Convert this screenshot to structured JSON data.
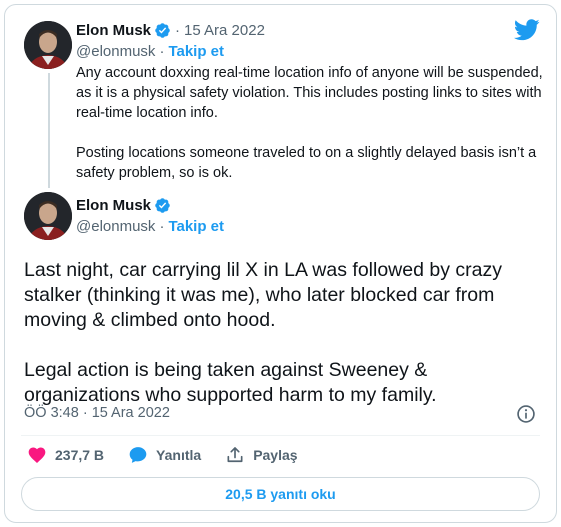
{
  "quoted_tweet": {
    "display_name": "Elon Musk",
    "handle": "@elonmusk",
    "separator": "·",
    "follow_label": "Takip et",
    "date": "15 Ara 2022",
    "text": "Any account doxxing real-time location info of anyone will be suspended, as it is a physical safety violation. This includes posting links to sites with real-time location info.\n\nPosting locations someone traveled to on a slightly delayed basis isn’t a safety problem, so is ok."
  },
  "main_tweet": {
    "display_name": "Elon Musk",
    "handle": "@elonmusk",
    "separator": "·",
    "follow_label": "Takip et",
    "text": "Last night, car carrying lil X in LA was followed by crazy stalker (thinking it was me), who later blocked car from moving & climbed onto hood.\n\nLegal action is being taken against Sweeney & organizations who supported harm to my family.",
    "timestamp": "ÖÖ 3:48 · 15 Ara 2022"
  },
  "actions": {
    "like_count": "237,7 B",
    "reply_label": "Yanıtla",
    "share_label": "Paylaş"
  },
  "read_replies_label": "20,5 B yanıtı oku",
  "icons": {
    "brand": "twitter-bird-icon",
    "verified": "verified-badge-icon",
    "info": "info-icon",
    "like": "heart-icon",
    "reply": "speech-bubble-icon",
    "share": "share-icon"
  },
  "colors": {
    "accent": "#1d9bf0",
    "like": "#f91880",
    "text": "#0f1419",
    "muted": "#536471",
    "border": "#cfd9de"
  }
}
